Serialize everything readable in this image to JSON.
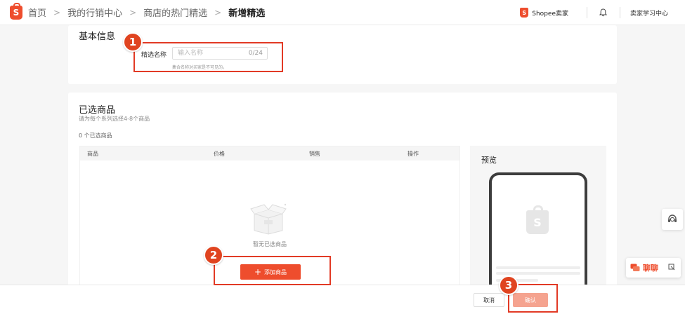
{
  "breadcrumb": {
    "items": [
      "首页",
      "我的行销中心",
      "商店的热门精选"
    ],
    "current": "新增精选"
  },
  "header": {
    "seller_brand": "Shopee卖家",
    "learning_center": "卖家学习中心"
  },
  "basic_info": {
    "title": "基本信息",
    "name_label": "精选名称",
    "name_placeholder": "输入名称",
    "name_count": "0/24",
    "name_hint": "集合名称对买家是不可见的。"
  },
  "selected_products": {
    "title": "已选商品",
    "subtitle": "请为每个系列选择4-8个商品",
    "count_label": "0 个已选商品",
    "columns": [
      "商品",
      "价格",
      "销售",
      "操作"
    ],
    "empty_text": "暂无已选商品",
    "add_button": "添加商品"
  },
  "preview": {
    "title": "预览"
  },
  "footer": {
    "cancel": "取消",
    "confirm": "确认"
  },
  "chat": {
    "label": "聊聊"
  },
  "markers": [
    "1",
    "2",
    "3"
  ],
  "colors": {
    "brand": "#ee4d2d",
    "highlight": "#e23a25",
    "confirm_disabled": "#f5a38f"
  }
}
